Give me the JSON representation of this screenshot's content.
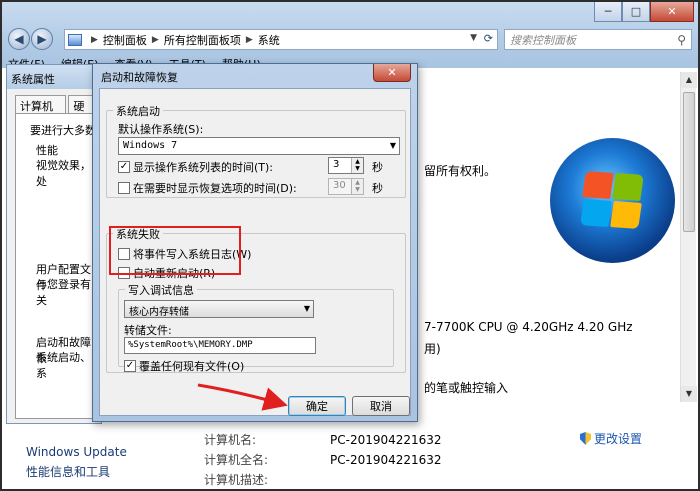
{
  "explorer": {
    "breadcrumbs": [
      "控制面板",
      "所有控制面板项",
      "系统"
    ],
    "search_placeholder": "搜索控制面板",
    "menu": [
      "文件(F)",
      "编辑(E)",
      "查看(V)",
      "工具(T)",
      "帮助(H)"
    ],
    "rights_text": "留所有权利。",
    "cpu_text": "7-7700K CPU @ 4.20GHz   4.20 GHz",
    "ram_text": "用)",
    "pen_text": "的笔或触控输入",
    "left_links": [
      "Windows Update",
      "性能信息和工具"
    ],
    "info_labels": [
      "计算机名:",
      "计算机全名:",
      "计算机描述:"
    ],
    "info_values": [
      "PC-201904221632",
      "PC-201904221632",
      ""
    ],
    "change_settings": "更改设置"
  },
  "system_properties": {
    "title": "系统属性",
    "tabs": [
      "计算机名",
      "硬件"
    ],
    "intro": "要进行大多数",
    "performance_label": "性能",
    "performance_text": "视觉效果，处",
    "profile_label": "用户配置文件",
    "profile_text": "与您登录有关",
    "startup_label": "启动和故障恢",
    "startup_text": "系统启动、系"
  },
  "dialog": {
    "title": "启动和故障恢复",
    "system_startup": {
      "legend": "系统启动",
      "default_os_label": "默认操作系统(S):",
      "default_os_value": "Windows 7",
      "show_os_list_label": "显示操作系统列表的时间(T):",
      "show_os_list_checked": true,
      "show_os_list_value": "3",
      "show_recovery_label": "在需要时显示恢复选项的时间(D):",
      "show_recovery_checked": false,
      "show_recovery_value": "30",
      "seconds_unit": "秒"
    },
    "system_failure": {
      "legend": "系统失败",
      "write_event_label": "将事件写入系统日志(W)",
      "write_event_checked": false,
      "auto_restart_label": "自动重新启动(R)",
      "auto_restart_checked": false
    },
    "debug_info": {
      "legend": "写入调试信息",
      "dump_type_value": "核心内存转储",
      "dump_file_label": "转储文件:",
      "dump_file_value": "%SystemRoot%\\MEMORY.DMP",
      "overwrite_label": "覆盖任何现有文件(O)",
      "overwrite_checked": true
    },
    "ok_label": "确定",
    "cancel_label": "取消"
  },
  "colors": {
    "highlight_box": "#e02020",
    "arrow": "#e02020"
  }
}
